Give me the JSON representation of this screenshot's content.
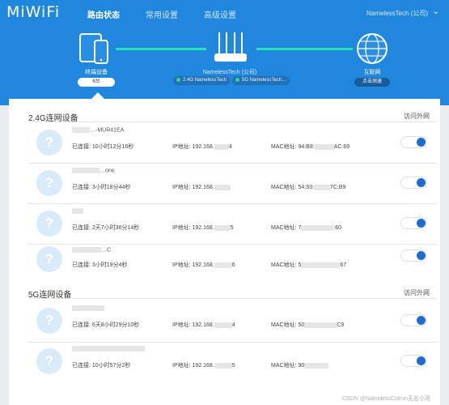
{
  "header": {
    "logo": "MiWiFi",
    "nav": [
      "路由状态",
      "常用设置",
      "高级设置"
    ],
    "account": "NamelessTech (公司)"
  },
  "topology": {
    "terminal": {
      "label": "终端设备",
      "count": "6台"
    },
    "router": {
      "name": "NamelessTech (公司)",
      "ssid_24": "2.4G NamelessTech",
      "ssid_5": "5G NamelessTech…"
    },
    "internet": {
      "label": "互联网",
      "speed_label": "点击测速"
    }
  },
  "sections": [
    {
      "title": "2.4G连网设备",
      "access_label": "访问外网",
      "devices": [
        {
          "name": "…-MUR41EA",
          "time": "已连接: 10小时12分16秒",
          "ip_prefix": "IP地址: 192.168.",
          "ip_suffix": "4",
          "mac_prefix": "MAC地址: 94:B8:",
          "mac_suffix": "AC:69",
          "enabled": true
        },
        {
          "name": "…one",
          "time": "已连接: 3小时18分44秒",
          "ip_prefix": "IP地址: 192.168.",
          "ip_suffix": "",
          "mac_prefix": "MAC地址: 54:33:",
          "mac_suffix": "7C:B9",
          "enabled": true
        },
        {
          "name": "",
          "time": "已连接: 2天7小时36分14秒",
          "ip_prefix": "IP地址: 192.168.",
          "ip_suffix": "5",
          "mac_prefix": "MAC地址: 7",
          "mac_suffix": ":60",
          "enabled": true
        },
        {
          "name": "…C",
          "time": "已连接: 3小时19分4秒",
          "ip_prefix": "IP地址: 192.168.",
          "ip_suffix": "6",
          "mac_prefix": "MAC地址: 5",
          "mac_suffix": "67",
          "enabled": true
        }
      ]
    },
    {
      "title": "5G连网设备",
      "access_label": "访问外网",
      "devices": [
        {
          "name": "",
          "time": "已连接: 6天8小时29分10秒",
          "ip_prefix": "IP地址: 192.168.",
          "ip_suffix": "4",
          "mac_prefix": "MAC地址: 50",
          "mac_suffix": "C9",
          "enabled": true
        },
        {
          "name": "",
          "time": "已连接: 10小时57分2秒",
          "ip_prefix": "IP地址: 192.168.",
          "ip_suffix": "5",
          "mac_prefix": "MAC地址: 90",
          "mac_suffix": "",
          "enabled": true
        }
      ]
    }
  ],
  "watermark": "CSDN @NamelessCotrun无名小哥",
  "colors": {
    "header_bg": "#1f87dd",
    "link_line": "#25e3b3",
    "toggle_on": "#1f6bd1",
    "avatar_bg": "#d9ebf8"
  }
}
